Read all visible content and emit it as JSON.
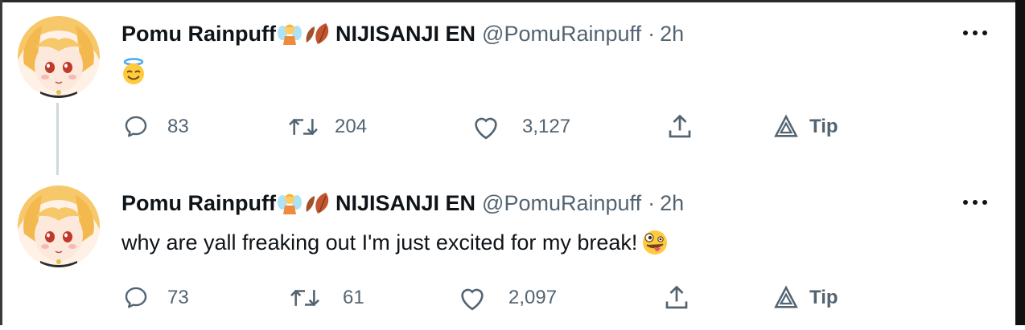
{
  "tweets": [
    {
      "display_name": "Pomu Rainpuff",
      "name_suffix": "NIJISANJI EN",
      "handle": "@PomuRainpuff",
      "separator": "·",
      "time": "2h",
      "text": "",
      "body_emoji": "smiling-face-with-halo",
      "replies": "83",
      "retweets": "204",
      "likes": "3,127",
      "tip_label": "Tip"
    },
    {
      "display_name": "Pomu Rainpuff",
      "name_suffix": "NIJISANJI EN",
      "handle": "@PomuRainpuff",
      "separator": "·",
      "time": "2h",
      "text": "why are yall freaking out I'm just excited for my break!",
      "body_emoji": "zany-face",
      "replies": "73",
      "retweets": "61",
      "likes": "2,097",
      "tip_label": "Tip"
    }
  ],
  "colors": {
    "text_primary": "#0f1419",
    "text_secondary": "#536471",
    "thread_line": "#cfd9de"
  }
}
